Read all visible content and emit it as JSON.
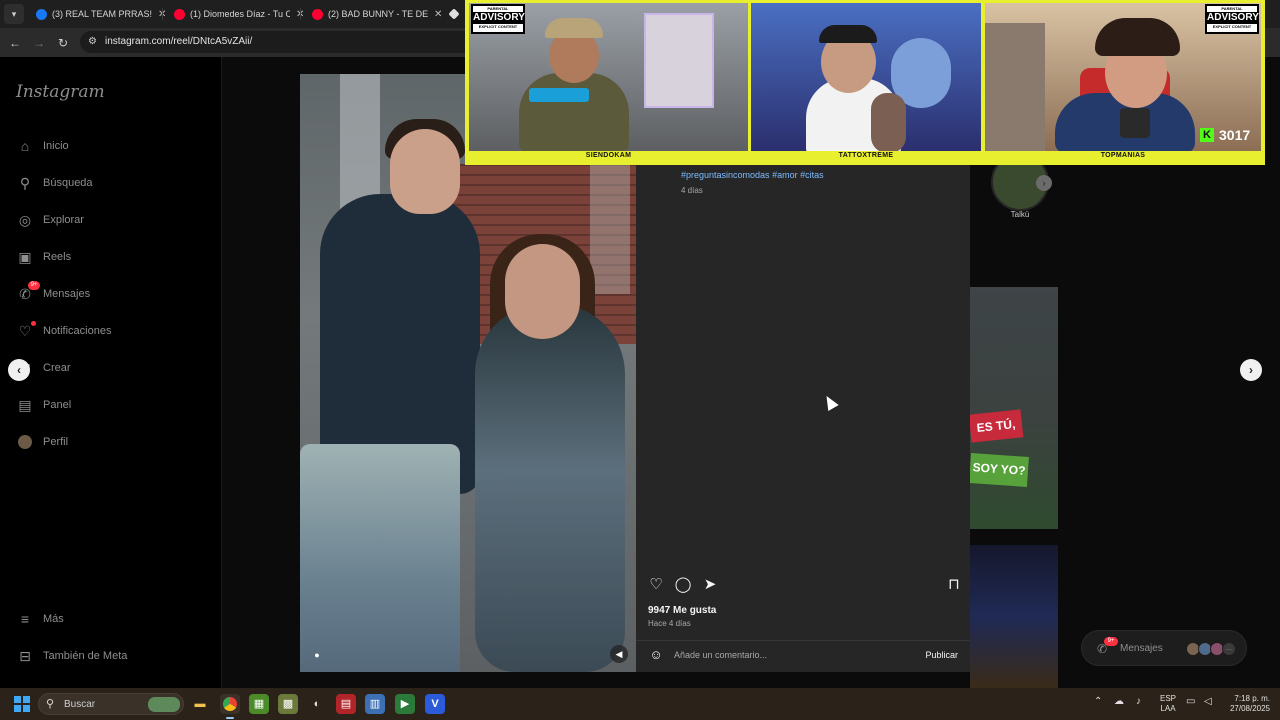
{
  "browser": {
    "tabs": [
      {
        "title": "(3) REAL TEAM PRRAS! | F",
        "favicon_color": "#1877f2"
      },
      {
        "title": "(1) Diomedes Díaz - Tu Cu",
        "favicon_color": "#ff0033"
      },
      {
        "title": "(2) BAD BUNNY - TE DESP",
        "favicon_color": "#ff0033"
      },
      {
        "title": "",
        "favicon_color": "#e0e0e0"
      }
    ],
    "url": "instagram.com/reel/DNtcA5vZAii/"
  },
  "sidebar": {
    "logo": "Instagram",
    "items": [
      {
        "label": "Inicio",
        "icon": "home-icon"
      },
      {
        "label": "Búsqueda",
        "icon": "search-icon"
      },
      {
        "label": "Explorar",
        "icon": "compass-icon"
      },
      {
        "label": "Reels",
        "icon": "reels-icon"
      },
      {
        "label": "Mensajes",
        "icon": "messenger-icon",
        "badge": "9+"
      },
      {
        "label": "Notificaciones",
        "icon": "heart-icon",
        "dot": true
      },
      {
        "label": "Crear",
        "icon": "plus-square-icon"
      },
      {
        "label": "Panel",
        "icon": "dashboard-icon"
      },
      {
        "label": "Perfil",
        "icon": "profile-avatar"
      }
    ],
    "more": "Más",
    "meta": "También de Meta"
  },
  "post": {
    "hashtags": [
      "#preguntasincomodas",
      "#amor",
      "#citas"
    ],
    "posted_short": "4 días",
    "likes": "9947 Me gusta",
    "posted": "Hace 4 días",
    "comment_placeholder": "Añade un comentario...",
    "publish": "Publicar"
  },
  "suggested": {
    "story_label": "Talkü",
    "sign_red": "ES TÚ,",
    "sign_green": "SOY YO?"
  },
  "messages_pill": {
    "label": "Mensajes",
    "badge": "9+"
  },
  "stream_overlay": {
    "cams": [
      {
        "label": "SIENDOKAM"
      },
      {
        "label": "TATTOXTREME"
      },
      {
        "label": "TOPMANIAS"
      }
    ],
    "advisory": {
      "line1": "PARENTAL",
      "line2": "ADVISORY",
      "line3": "EXPLICIT CONTENT"
    },
    "kick_count": "3017"
  },
  "taskbar": {
    "search_placeholder": "Buscar",
    "lang_top": "ESP",
    "lang_bottom": "LAA",
    "time": "7:18 p. m.",
    "date": "27/08/2025"
  },
  "colors": {
    "overlay_yellow": "#e8ef2f",
    "instagram_panel": "#262626",
    "link_blue": "#7dbcff",
    "notification_red": "#ff3040",
    "kick_green": "#53fc18"
  }
}
